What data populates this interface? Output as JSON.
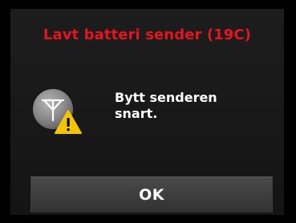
{
  "dialog": {
    "title": "Lavt batteri sender (19C)",
    "message_line1": "Bytt senderen",
    "message_line2": "snart.",
    "ok_label": "OK",
    "icon": "transmitter-warning-icon"
  },
  "colors": {
    "title": "#e6141e",
    "background": "#1a1a1a",
    "button": "#404040",
    "warning": "#f2c500"
  }
}
